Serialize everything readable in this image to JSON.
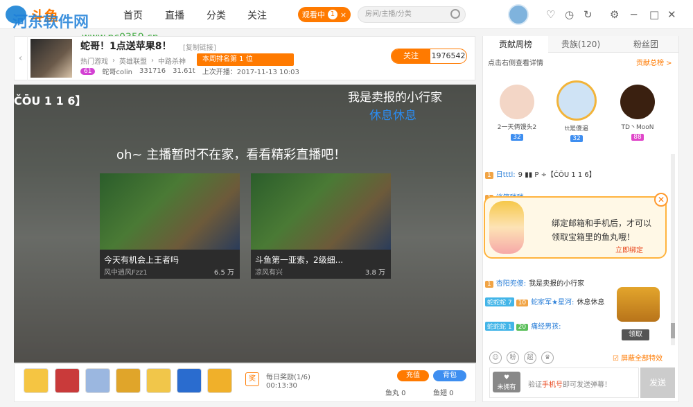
{
  "app": {
    "logo_text": "斗鱼",
    "watermark": "河东软件网",
    "watermark_url": "www.pc0359.cn"
  },
  "nav": {
    "home": "首页",
    "live": "直播",
    "category": "分类",
    "follow": "关注",
    "watching": "观看中",
    "watching_count": "1",
    "close": "×"
  },
  "search": {
    "placeholder": "房间/主播/分类"
  },
  "window": {
    "heart": "♡",
    "history": "◷",
    "refresh": "↻",
    "settings": "⚙",
    "minimize": "─",
    "maximize": "□",
    "close": "✕"
  },
  "room": {
    "title": "蛇哥！1点送苹果8！",
    "copy_link": "[复制链接]",
    "crumbs": [
      "热门游戏",
      "英雄联盟",
      "中路杀神"
    ],
    "rank_label": "本周排名第 1 位",
    "host_level": "61",
    "host_name": "蛇哥colin",
    "followers_stat": "331716",
    "weight": "31.61t",
    "last_live": "上次开播：2017-11-13 10:03",
    "follow_label": "关注",
    "follow_count": "1976542"
  },
  "video": {
    "tag": "ČŌU 1 1 6】",
    "caption1": "我是卖报的小行家",
    "caption2": "休息休息",
    "offline_msg": "oh~ 主播暂时不在家，看看精彩直播吧！",
    "cards": [
      {
        "title": "今天有机会上王者吗",
        "user": "风中逍风Fzz1",
        "views": "6.5 万"
      },
      {
        "title": "斗鱼第一亚索，2级细...",
        "user": "凉风有兴",
        "views": "3.8 万"
      }
    ]
  },
  "giftbar": {
    "daily": "每日奖励(1/6)",
    "daily_time": "00:13:30",
    "daily_icon": "奖",
    "recharge": "充值",
    "backpack": "背包",
    "yuwan": "鱼丸 0",
    "yuchi": "鱼翅 0"
  },
  "panel": {
    "tabs": [
      "贡献周榜",
      "贵族(120)",
      "粉丝团"
    ],
    "click_tip": "点击右侧查看详情",
    "rank_total": "贡献总榜 >",
    "top3": [
      {
        "name": "2一天俩馒头2",
        "badge": "32"
      },
      {
        "name": "tt是傻逼",
        "badge": "32"
      },
      {
        "name": "TD丶MooN",
        "badge": "88"
      }
    ],
    "chat": [
      {
        "lv": "1",
        "user": "日tttl:",
        "text": "9 ▮▮ P ÷【ČŌU 1 1 6】"
      },
      {
        "lv": "1",
        "user": "谈笑嗤嗤:",
        "text": ""
      },
      {
        "lv": "1",
        "user": "杏阳兜傻:",
        "text": "我是卖报的小行家"
      },
      {
        "fan": "蛇蛇蛇",
        "fanlv": "7",
        "lv": "10",
        "user": "蛇家军★星河:",
        "text": "休息休息"
      },
      {
        "fan": "蛇蛇蛇",
        "fanlv": "1",
        "lv": "20",
        "user": "痛经男孩:",
        "text": ""
      }
    ],
    "popup_line1": "绑定邮箱和手机后，才可以",
    "popup_line2": "领取宝箱里的鱼丸哦！",
    "popup_bind": "立即绑定",
    "claim": "领取",
    "emojis": [
      "☺",
      "粉",
      "超",
      "♛"
    ],
    "block_effects": "屏蔽全部特效",
    "unowned": "未拥有",
    "verify_prefix": "验证",
    "verify_highlight": "手机号",
    "verify_suffix": "即可发送弹幕！",
    "send": "发送"
  }
}
